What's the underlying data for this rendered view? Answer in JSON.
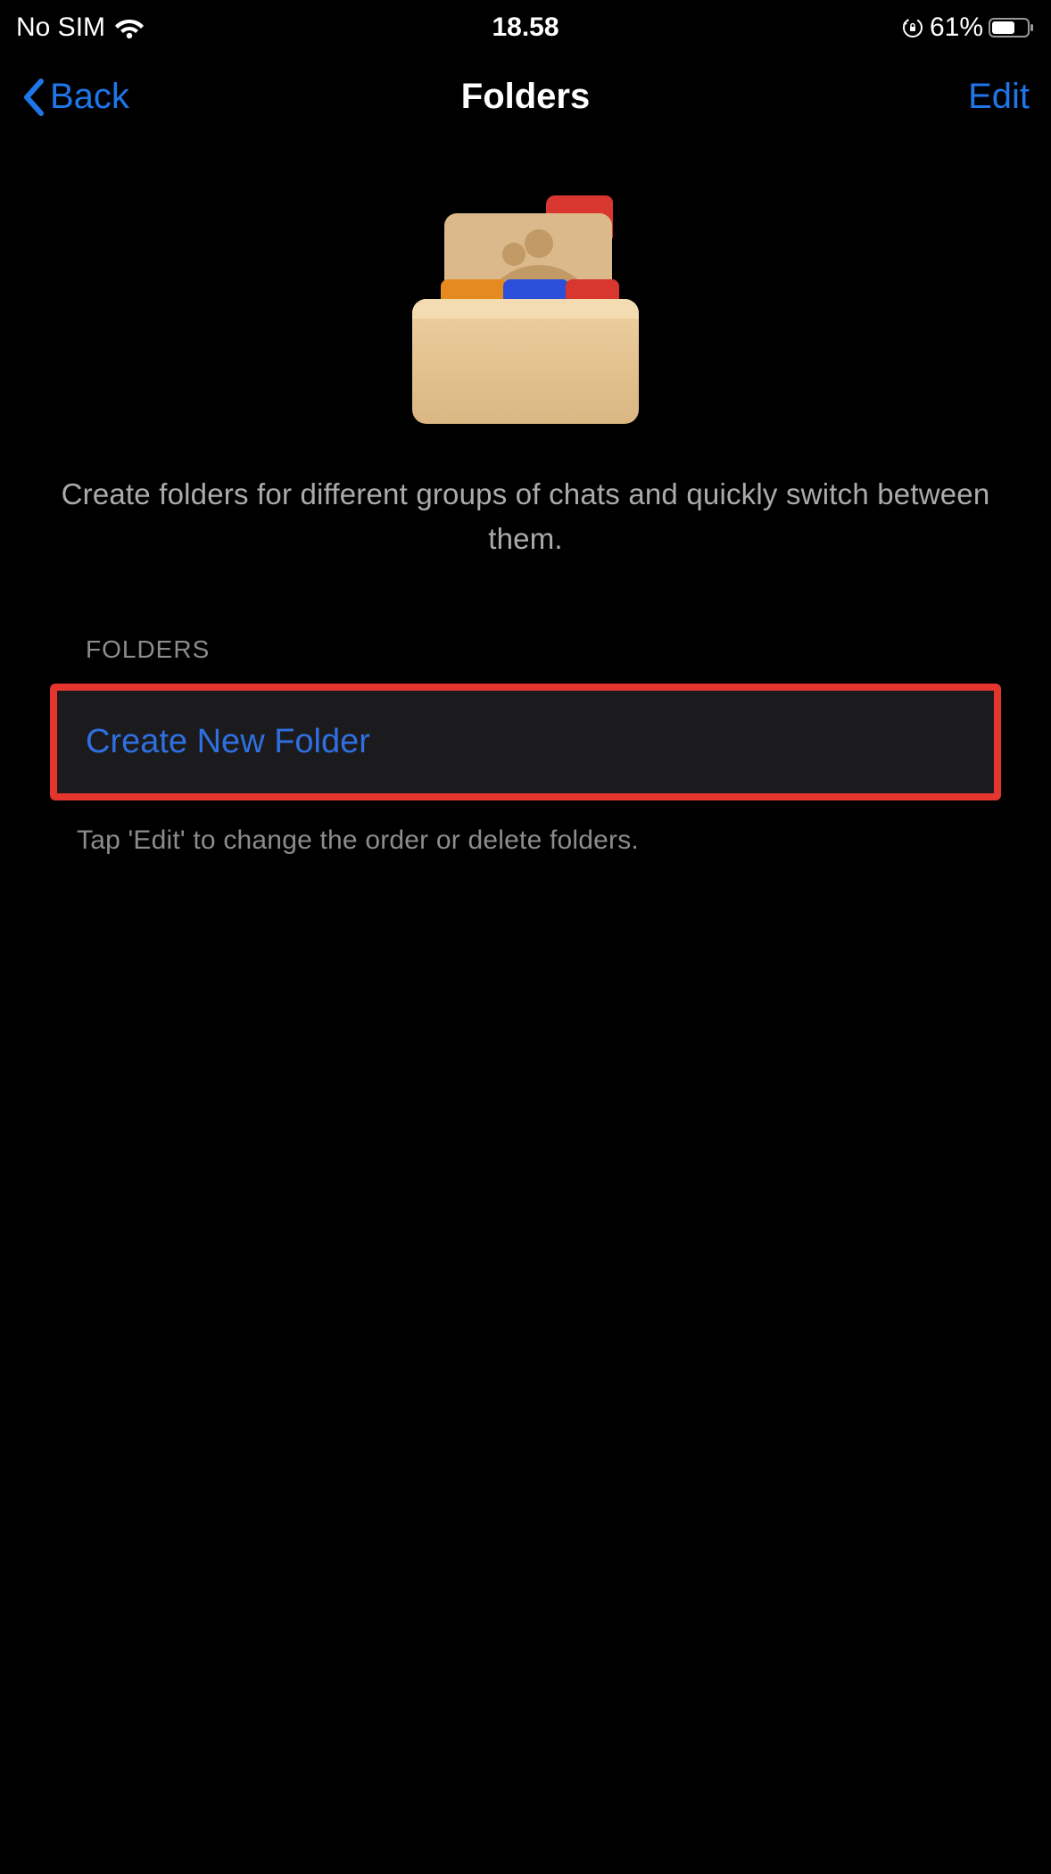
{
  "status_bar": {
    "carrier": "No SIM",
    "time": "18.58",
    "battery_percent": "61%"
  },
  "nav": {
    "back_label": "Back",
    "title": "Folders",
    "edit_label": "Edit"
  },
  "hero": {
    "description": "Create folders for different groups of chats and quickly switch between them."
  },
  "section": {
    "header": "FOLDERS",
    "create_label": "Create New Folder",
    "footer": "Tap 'Edit' to change the order or delete folders."
  }
}
